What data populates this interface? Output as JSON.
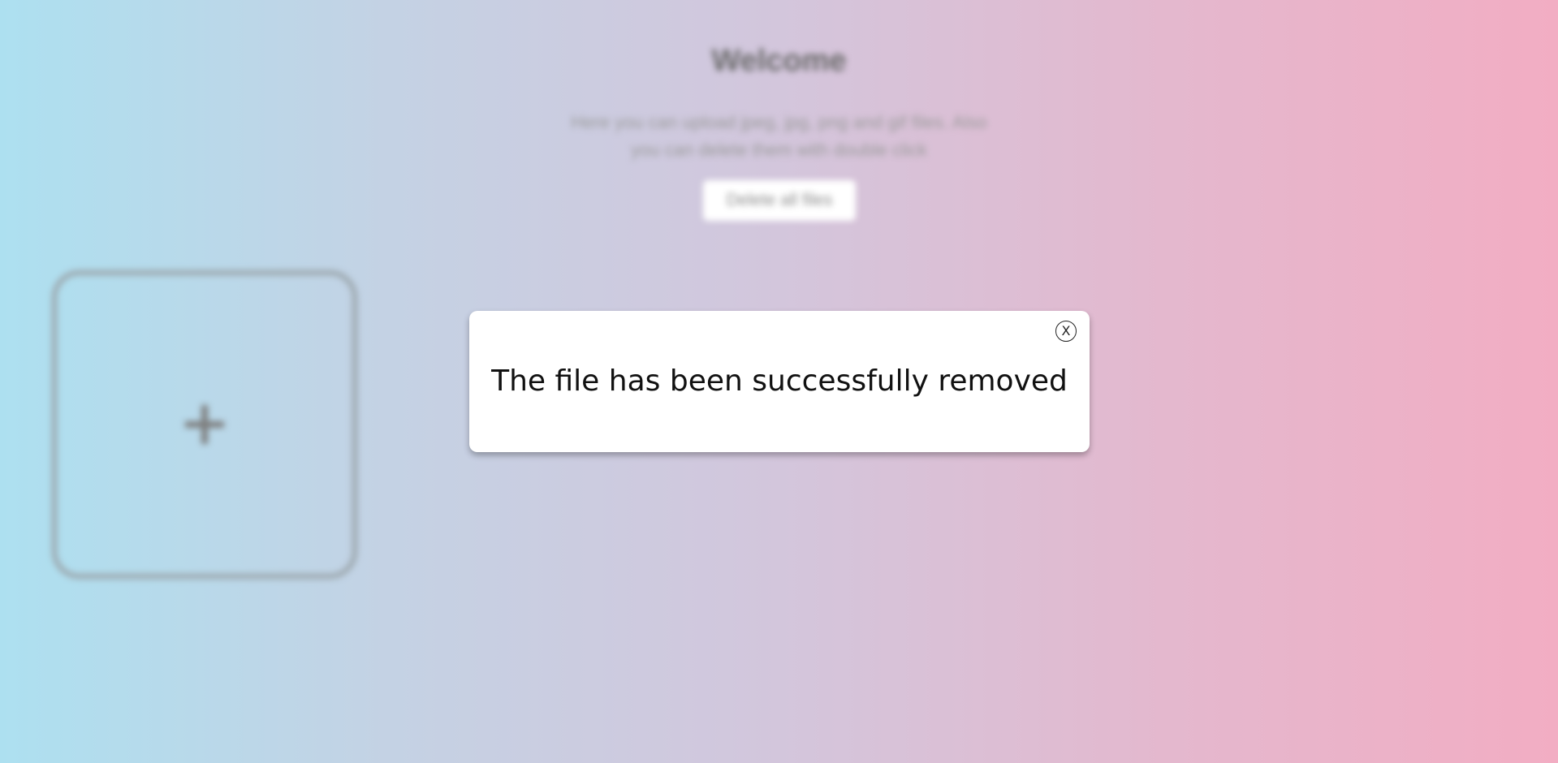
{
  "background": {
    "welcome_title": "Welcome",
    "description_lines": [
      "Here you can upload jpeg, jpg, png and gif files. Also",
      "you can delete them with double click"
    ],
    "delete_all_label": "Delete all files",
    "upload_tile": {
      "icon": "plus-icon"
    }
  },
  "modal": {
    "message": "The file has been successfully removed",
    "close_label": "X",
    "close_icon": "close-icon"
  },
  "colors": {
    "gradient_left": "#ade0f0",
    "gradient_right": "#f2adc3",
    "modal_bg": "#ffffff"
  }
}
